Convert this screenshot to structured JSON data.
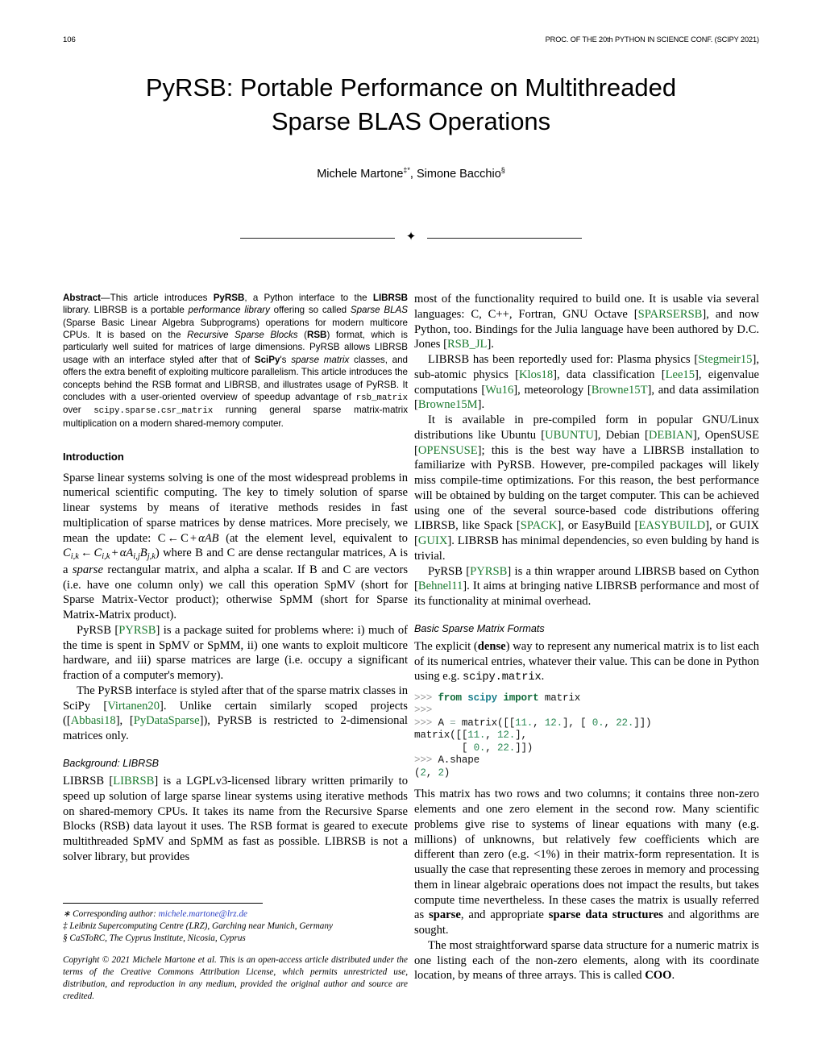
{
  "running_head": {
    "page_number": "106",
    "conference": "PROC. OF THE 20th PYTHON IN SCIENCE CONF. (SCIPY 2021)"
  },
  "title": {
    "line1": "PyRSB: Portable Performance on Multithreaded",
    "line2": "Sparse BLAS Operations"
  },
  "authors": {
    "author1_name": "Michele Martone",
    "author1_marks": "‡*",
    "separator": ", ",
    "author2_name": "Simone Bacchio",
    "author2_marks": "§"
  },
  "ornament": {
    "glyph": "✦"
  },
  "abstract": {
    "label": "Abstract",
    "dash": "—",
    "t1": "This article introduces ",
    "b1": "PyRSB",
    "t2": ", a Python interface to the ",
    "b2": "LIBRSB",
    "t3": " library. LIBRSB is a portable ",
    "i1": "performance library",
    "t4": " offering so called ",
    "i2": "Sparse BLAS",
    "t5": " (Sparse Basic Linear Algebra Subprograms) operations for modern multicore CPUs. It is based on the ",
    "i3": "Recursive Sparse Blocks",
    "t6": " (",
    "b3": "RSB",
    "t7": ") format, which is particularly well suited for matrices of large dimensions. PyRSB allows LIBRSB usage with an interface styled after that of ",
    "b4": "SciPy",
    "t8": "'s ",
    "i4": "sparse matrix",
    "t9": " classes, and offers the extra benefit of exploiting multicore parallelism. This article introduces the concepts behind the RSB format and LIBRSB, and illustrates usage of PyRSB. It concludes with a user-oriented overview of speedup advantage of ",
    "m1": "rsb_matrix",
    "t10": " over ",
    "m2": "scipy.sparse.csr_matrix",
    "t11": " running general sparse matrix-matrix multiplication on a modern shared-memory computer."
  },
  "sections": {
    "introduction": "Introduction",
    "background": "Background: LIBRSB",
    "formats": "Basic Sparse Matrix Formats"
  },
  "intro": {
    "p1_a": "Sparse linear systems solving is one of the most widespread problems in numerical scientific computing. The key to timely solution of sparse linear systems by means of iterative methods resides in fast multiplication of sparse matrices by dense matrices. More precisely, we mean the update: ",
    "p1_math1": "C ← C + αAB",
    "p1_b": " (at the element level, equivalent to ",
    "p1_math2": "Cᵢ,ₖ ← Cᵢ,ₖ + αAᵢ,ⱼBⱼ,ₖ",
    "p1_c": ") where B and C are dense rectangular matrices, A is a ",
    "p1_i1": "sparse",
    "p1_d": " rectangular matrix, and alpha a scalar. If B and C are vectors (i.e. have one column only) we call this operation SpMV (short for Sparse Matrix-Vector product); otherwise SpMM (short for Sparse Matrix-Matrix product).",
    "p2_a": "PyRSB [",
    "p2_cite1": "PYRSB",
    "p2_b": "] is a package suited for problems where: i) much of the time is spent in SpMV or SpMM, ii) one wants to exploit multicore hardware, and iii) sparse matrices are large (i.e. occupy a significant fraction of a computer's memory).",
    "p3_a": "The PyRSB interface is styled after that of the sparse matrix classes in SciPy [",
    "p3_cite1": "Virtanen20",
    "p3_b": "]. Unlike certain similarly scoped projects ([",
    "p3_cite2": "Abbasi18",
    "p3_c": "], [",
    "p3_cite3": "PyDataSparse",
    "p3_d": "]), PyRSB is restricted to 2-dimensional matrices only."
  },
  "background": {
    "p1_a": "LIBRSB [",
    "p1_cite1": "LIBRSB",
    "p1_b": "] is a LGPLv3-licensed library written primarily to speed up solution of large sparse linear systems using iterative methods on shared-memory CPUs. It takes its name from the Recursive Sparse Blocks (RSB) data layout it uses. The RSB format is geared to execute multithreaded SpMV and SpMM as fast as possible. LIBRSB is not a solver library, but provides",
    "p1_cont_a": "most of the functionality required to build one. It is usable via several languages: C, C++, Fortran, GNU Octave [",
    "p1_cont_cite1": "SPARSERSB",
    "p1_cont_b": "], and now Python, too. Bindings for the Julia language have been authored by D.C. Jones [",
    "p1_cont_cite2": "RSB_JL",
    "p1_cont_c": "].",
    "p2_a": "LIBRSB has been reportedly used for: Plasma physics [",
    "p2_cite1": "Stegmeir15",
    "p2_b": "], sub-atomic physics [",
    "p2_cite2": "Klos18",
    "p2_c": "], data classification [",
    "p2_cite3": "Lee15",
    "p2_d": "], eigenvalue computations [",
    "p2_cite4": "Wu16",
    "p2_e": "], meteorology [",
    "p2_cite5": "Browne15T",
    "p2_f": "], and data assimilation [",
    "p2_cite6": "Browne15M",
    "p2_g": "].",
    "p3_a": "It is available in pre-compiled form in popular GNU/Linux distributions like Ubuntu [",
    "p3_cite1": "UBUNTU",
    "p3_b": "], Debian [",
    "p3_cite2": "DEBIAN",
    "p3_c": "], OpenSUSE [",
    "p3_cite3": "OPENSUSE",
    "p3_d": "]; this is the best way have a LIBRSB installation to familiarize with PyRSB. However, pre-compiled packages will likely miss compile-time optimizations. For this reason, the best performance will be obtained by bulding on the target computer. This can be achieved using one of the several source-based code distributions offering LIBRSB, like Spack [",
    "p3_cite4": "SPACK",
    "p3_e": "], or EasyBuild [",
    "p3_cite5": "EASYBUILD",
    "p3_f": "], or GUIX [",
    "p3_cite6": "GUIX",
    "p3_g": "]. LIBRSB has minimal dependencies, so even bulding by hand is trivial.",
    "p4_a": "PyRSB [",
    "p4_cite1": "PYRSB",
    "p4_b": "] is a thin wrapper around LIBRSB based on Cython [",
    "p4_cite2": "Behnel11",
    "p4_c": "]. It aims at bringing native LIBRSB performance and most of its functionality at minimal overhead."
  },
  "formats": {
    "p1_a": "The explicit (",
    "p1_b1": "dense",
    "p1_b": ") way to represent any numerical matrix is to list each of its numerical entries, whatever their value. This can be done in Python using e.g. ",
    "p1_m1": "scipy.matrix",
    "p1_c": ".",
    "code": {
      "l1_prompt": ">>> ",
      "l1_kw1": "from",
      "l1_mod": " scipy ",
      "l1_kw2": "import",
      "l1_rest": " matrix",
      "l2_prompt": ">>>",
      "l3_prompt": ">>> ",
      "l3_a": "A ",
      "l3_op": "=",
      "l3_b": " matrix([[",
      "l3_n1": "11.",
      "l3_c": ", ",
      "l3_n2": "12.",
      "l3_d": "], [ ",
      "l3_n3": "0.",
      "l3_e": ", ",
      "l3_n4": "22.",
      "l3_f": "]])",
      "l4_a": "matrix([[",
      "l4_n1": "11.",
      "l4_b": ", ",
      "l4_n2": "12.",
      "l4_c": "],",
      "l5_a": "        [ ",
      "l5_n1": "0.",
      "l5_b": ", ",
      "l5_n2": "22.",
      "l5_c": "]])",
      "l6_prompt": ">>> ",
      "l6_rest": "A.shape",
      "l7_a": "(",
      "l7_n1": "2",
      "l7_b": ", ",
      "l7_n2": "2",
      "l7_c": ")"
    },
    "p2": "This matrix has two rows and two columns; it contains three non-zero elements and one zero element in the second row. Many scientific problems give rise to systems of linear equations with many (e.g. millions) of unknowns, but relatively few coefficients which are different than zero (e.g. <1%) in their matrix-form representation. It is usually the case that representing these zeroes in memory and processing them in linear algebraic operations does not impact the results, but takes compute time nevertheless. In these cases the matrix is usually referred as ",
    "p2_b1": "sparse",
    "p2_b": ", and appropriate ",
    "p2_b2": "sparse data structures",
    "p2_c": " and algorithms are sought.",
    "p3_a": "The most straightforward sparse data structure for a numeric matrix is one listing each of the non-zero elements, along with its coordinate location, by means of three arrays. This is called ",
    "p3_b1": "COO",
    "p3_b": "."
  },
  "footnotes": {
    "line1_mark": "∗ ",
    "line1_text": "Corresponding author: ",
    "line1_email": "michele.martone@lrz.de",
    "line2": "‡ Leibniz Supercomputing Centre (LRZ), Garching near Munich, Germany",
    "line3": "§ CaSToRC, The Cyprus Institute, Nicosia, Cyprus",
    "copyright": "Copyright © 2021 Michele Martone et al. This is an open-access article distributed under the terms of the Creative Commons Attribution License, which permits unrestricted use, distribution, and reproduction in any medium, provided the original author and source are credited."
  }
}
